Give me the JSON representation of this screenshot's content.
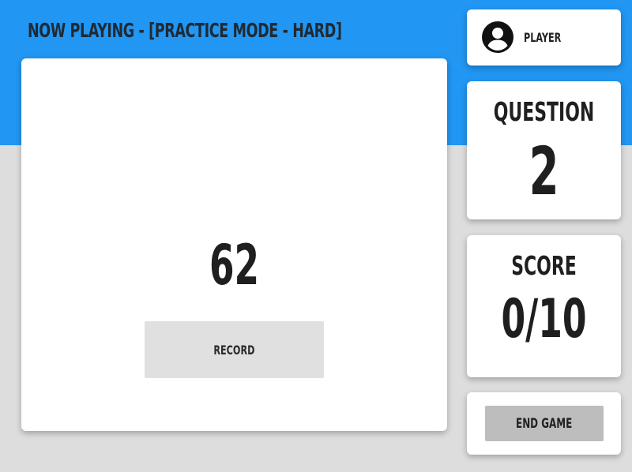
{
  "header": {
    "title": "NOW PLAYING - [PRACTICE MODE - HARD]",
    "background_color": "#2196f3"
  },
  "main": {
    "number": "62",
    "record_label": "RECORD"
  },
  "player": {
    "icon": "account-circle-icon",
    "name": "PLAYER"
  },
  "question": {
    "label": "QUESTION",
    "value": "2"
  },
  "score": {
    "label": "SCORE",
    "value": "0/10"
  },
  "end_game": {
    "label": "END GAME"
  }
}
